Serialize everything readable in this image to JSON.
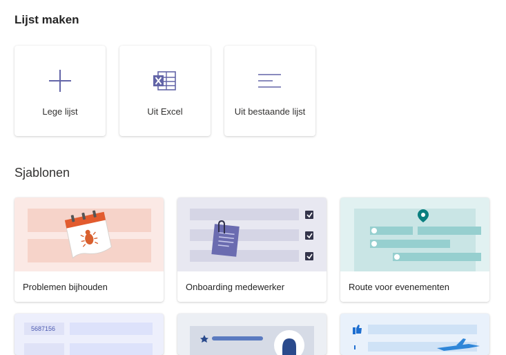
{
  "create": {
    "title": "Lijst maken",
    "options": [
      {
        "label": "Lege lijst",
        "icon": "plus-icon"
      },
      {
        "label": "Uit Excel",
        "icon": "excel-icon"
      },
      {
        "label": "Uit bestaande lijst",
        "icon": "list-lines-icon"
      }
    ]
  },
  "templates": {
    "title": "Sjablonen",
    "items": [
      {
        "label": "Problemen bijhouden",
        "icon": "calendar-bug-illustration"
      },
      {
        "label": "Onboarding medewerker",
        "icon": "clipboard-checklist-illustration"
      },
      {
        "label": "Route voor evenementen",
        "icon": "map-pin-illustration"
      }
    ],
    "partial_row": {
      "first_card_id_text": "5687156"
    }
  },
  "colors": {
    "accent": "#6264a7",
    "excel_icon": "#6264a7",
    "issue_bg": "#fbe9e5",
    "onboarding_bg": "#e8e8f1",
    "route_bg": "#e1f1f1"
  }
}
